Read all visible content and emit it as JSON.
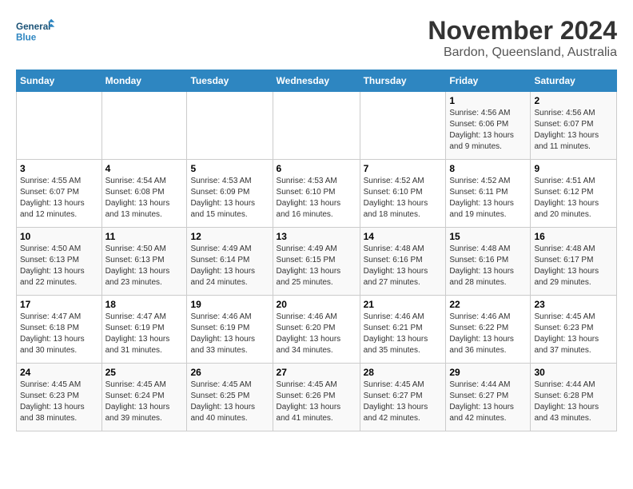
{
  "logo": {
    "line1": "General",
    "line2": "Blue"
  },
  "title": "November 2024",
  "location": "Bardon, Queensland, Australia",
  "days_header": [
    "Sunday",
    "Monday",
    "Tuesday",
    "Wednesday",
    "Thursday",
    "Friday",
    "Saturday"
  ],
  "weeks": [
    [
      {
        "day": "",
        "info": ""
      },
      {
        "day": "",
        "info": ""
      },
      {
        "day": "",
        "info": ""
      },
      {
        "day": "",
        "info": ""
      },
      {
        "day": "",
        "info": ""
      },
      {
        "day": "1",
        "info": "Sunrise: 4:56 AM\nSunset: 6:06 PM\nDaylight: 13 hours and 9 minutes."
      },
      {
        "day": "2",
        "info": "Sunrise: 4:56 AM\nSunset: 6:07 PM\nDaylight: 13 hours and 11 minutes."
      }
    ],
    [
      {
        "day": "3",
        "info": "Sunrise: 4:55 AM\nSunset: 6:07 PM\nDaylight: 13 hours and 12 minutes."
      },
      {
        "day": "4",
        "info": "Sunrise: 4:54 AM\nSunset: 6:08 PM\nDaylight: 13 hours and 13 minutes."
      },
      {
        "day": "5",
        "info": "Sunrise: 4:53 AM\nSunset: 6:09 PM\nDaylight: 13 hours and 15 minutes."
      },
      {
        "day": "6",
        "info": "Sunrise: 4:53 AM\nSunset: 6:10 PM\nDaylight: 13 hours and 16 minutes."
      },
      {
        "day": "7",
        "info": "Sunrise: 4:52 AM\nSunset: 6:10 PM\nDaylight: 13 hours and 18 minutes."
      },
      {
        "day": "8",
        "info": "Sunrise: 4:52 AM\nSunset: 6:11 PM\nDaylight: 13 hours and 19 minutes."
      },
      {
        "day": "9",
        "info": "Sunrise: 4:51 AM\nSunset: 6:12 PM\nDaylight: 13 hours and 20 minutes."
      }
    ],
    [
      {
        "day": "10",
        "info": "Sunrise: 4:50 AM\nSunset: 6:13 PM\nDaylight: 13 hours and 22 minutes."
      },
      {
        "day": "11",
        "info": "Sunrise: 4:50 AM\nSunset: 6:13 PM\nDaylight: 13 hours and 23 minutes."
      },
      {
        "day": "12",
        "info": "Sunrise: 4:49 AM\nSunset: 6:14 PM\nDaylight: 13 hours and 24 minutes."
      },
      {
        "day": "13",
        "info": "Sunrise: 4:49 AM\nSunset: 6:15 PM\nDaylight: 13 hours and 25 minutes."
      },
      {
        "day": "14",
        "info": "Sunrise: 4:48 AM\nSunset: 6:16 PM\nDaylight: 13 hours and 27 minutes."
      },
      {
        "day": "15",
        "info": "Sunrise: 4:48 AM\nSunset: 6:16 PM\nDaylight: 13 hours and 28 minutes."
      },
      {
        "day": "16",
        "info": "Sunrise: 4:48 AM\nSunset: 6:17 PM\nDaylight: 13 hours and 29 minutes."
      }
    ],
    [
      {
        "day": "17",
        "info": "Sunrise: 4:47 AM\nSunset: 6:18 PM\nDaylight: 13 hours and 30 minutes."
      },
      {
        "day": "18",
        "info": "Sunrise: 4:47 AM\nSunset: 6:19 PM\nDaylight: 13 hours and 31 minutes."
      },
      {
        "day": "19",
        "info": "Sunrise: 4:46 AM\nSunset: 6:19 PM\nDaylight: 13 hours and 33 minutes."
      },
      {
        "day": "20",
        "info": "Sunrise: 4:46 AM\nSunset: 6:20 PM\nDaylight: 13 hours and 34 minutes."
      },
      {
        "day": "21",
        "info": "Sunrise: 4:46 AM\nSunset: 6:21 PM\nDaylight: 13 hours and 35 minutes."
      },
      {
        "day": "22",
        "info": "Sunrise: 4:46 AM\nSunset: 6:22 PM\nDaylight: 13 hours and 36 minutes."
      },
      {
        "day": "23",
        "info": "Sunrise: 4:45 AM\nSunset: 6:23 PM\nDaylight: 13 hours and 37 minutes."
      }
    ],
    [
      {
        "day": "24",
        "info": "Sunrise: 4:45 AM\nSunset: 6:23 PM\nDaylight: 13 hours and 38 minutes."
      },
      {
        "day": "25",
        "info": "Sunrise: 4:45 AM\nSunset: 6:24 PM\nDaylight: 13 hours and 39 minutes."
      },
      {
        "day": "26",
        "info": "Sunrise: 4:45 AM\nSunset: 6:25 PM\nDaylight: 13 hours and 40 minutes."
      },
      {
        "day": "27",
        "info": "Sunrise: 4:45 AM\nSunset: 6:26 PM\nDaylight: 13 hours and 41 minutes."
      },
      {
        "day": "28",
        "info": "Sunrise: 4:45 AM\nSunset: 6:27 PM\nDaylight: 13 hours and 42 minutes."
      },
      {
        "day": "29",
        "info": "Sunrise: 4:44 AM\nSunset: 6:27 PM\nDaylight: 13 hours and 42 minutes."
      },
      {
        "day": "30",
        "info": "Sunrise: 4:44 AM\nSunset: 6:28 PM\nDaylight: 13 hours and 43 minutes."
      }
    ]
  ]
}
